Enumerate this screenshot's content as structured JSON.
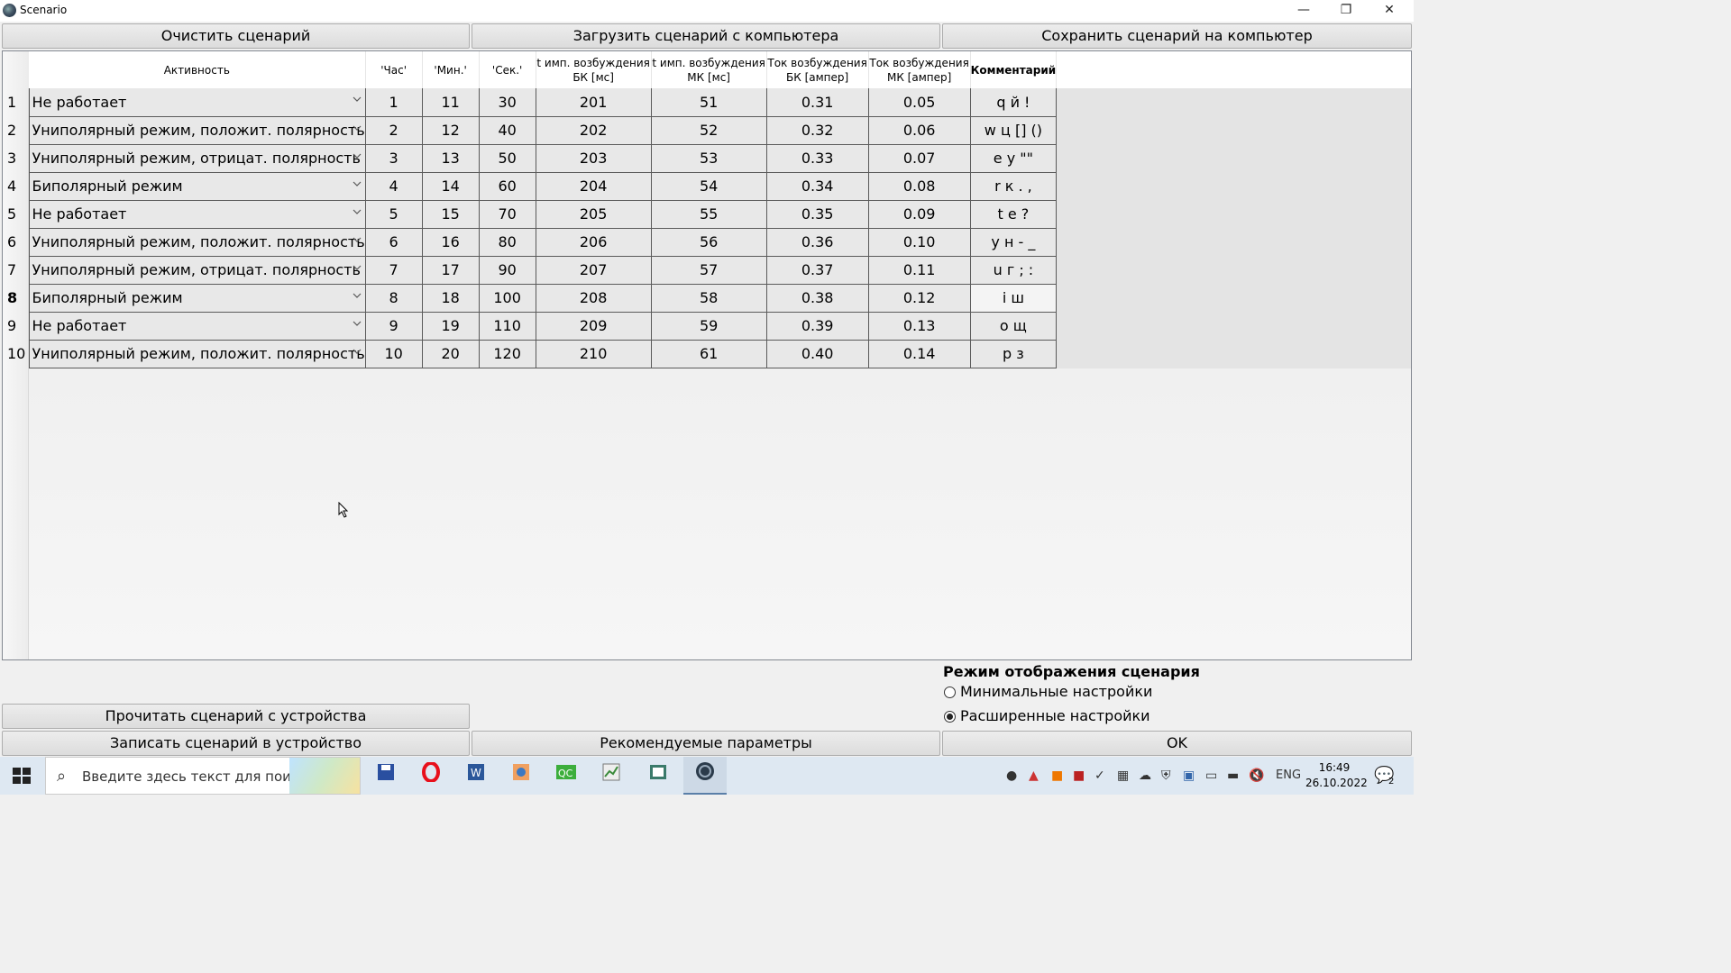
{
  "window": {
    "title": "Scenario",
    "minimize": "—",
    "restore": "❐",
    "close": "✕"
  },
  "toolbar": {
    "clear": "Очистить сценарий",
    "load": "Загрузить сценарий с компьютера",
    "save": "Сохранить сценарий на компьютер"
  },
  "table": {
    "headers": {
      "activity": "Активность",
      "hour": "'Час'",
      "min": "'Мин.'",
      "sec": "'Сек.'",
      "t_bk_1": "t имп. возбуждения",
      "t_bk_2": "БК [мс]",
      "t_mk_1": "t имп. возбуждения",
      "t_mk_2": "МК [мс]",
      "i_bk_1": "Ток возбуждения",
      "i_bk_2": "БК [ампер]",
      "i_mk_1": "Ток возбуждения",
      "i_mk_2": "МК [ампер]",
      "comment": "Комментарий"
    },
    "rows": [
      {
        "n": "1",
        "activity": "Не работает",
        "hour": "1",
        "min": "11",
        "sec": "30",
        "t_bk": "201",
        "t_mk": "51",
        "i_bk": "0.31",
        "i_mk": "0.05",
        "comment": "q й !"
      },
      {
        "n": "2",
        "activity": "Униполярный режим, положит. полярность",
        "hour": "2",
        "min": "12",
        "sec": "40",
        "t_bk": "202",
        "t_mk": "52",
        "i_bk": "0.32",
        "i_mk": "0.06",
        "comment": "w ц [] ()"
      },
      {
        "n": "3",
        "activity": "Униполярный режим, отрицат. полярность",
        "hour": "3",
        "min": "13",
        "sec": "50",
        "t_bk": "203",
        "t_mk": "53",
        "i_bk": "0.33",
        "i_mk": "0.07",
        "comment": "e у \"\""
      },
      {
        "n": "4",
        "activity": "Биполярный режим",
        "hour": "4",
        "min": "14",
        "sec": "60",
        "t_bk": "204",
        "t_mk": "54",
        "i_bk": "0.34",
        "i_mk": "0.08",
        "comment": "r к . ,"
      },
      {
        "n": "5",
        "activity": "Не работает",
        "hour": "5",
        "min": "15",
        "sec": "70",
        "t_bk": "205",
        "t_mk": "55",
        "i_bk": "0.35",
        "i_mk": "0.09",
        "comment": "t е ?"
      },
      {
        "n": "6",
        "activity": "Униполярный режим, положит. полярность",
        "hour": "6",
        "min": "16",
        "sec": "80",
        "t_bk": "206",
        "t_mk": "56",
        "i_bk": "0.36",
        "i_mk": "0.10",
        "comment": "y н - _"
      },
      {
        "n": "7",
        "activity": "Униполярный режим, отрицат. полярность",
        "hour": "7",
        "min": "17",
        "sec": "90",
        "t_bk": "207",
        "t_mk": "57",
        "i_bk": "0.37",
        "i_mk": "0.11",
        "comment": "u г ; :"
      },
      {
        "n": "8",
        "activity": "Биполярный режим",
        "hour": "8",
        "min": "18",
        "sec": "100",
        "t_bk": "208",
        "t_mk": "58",
        "i_bk": "0.38",
        "i_mk": "0.12",
        "comment": "i ш"
      },
      {
        "n": "9",
        "activity": "Не работает",
        "hour": "9",
        "min": "19",
        "sec": "110",
        "t_bk": "209",
        "t_mk": "59",
        "i_bk": "0.39",
        "i_mk": "0.13",
        "comment": "o щ"
      },
      {
        "n": "10",
        "activity": "Униполярный режим, положит. полярность",
        "hour": "10",
        "min": "20",
        "sec": "120",
        "t_bk": "210",
        "t_mk": "61",
        "i_bk": "0.40",
        "i_mk": "0.14",
        "comment": "p з"
      }
    ],
    "current_row": "8"
  },
  "display_mode": {
    "title": "Режим отображения сценария",
    "options": [
      {
        "label": "Минимальные настройки",
        "checked": false
      },
      {
        "label": "Расширенные настройки",
        "checked": true
      }
    ]
  },
  "bottom": {
    "read": "Прочитать сценарий с устройства",
    "write": "Записать сценарий в устройство",
    "recommended": "Рекомендуемые параметры",
    "ok": "OK"
  },
  "taskbar": {
    "search_placeholder": "Введите здесь текст для поиска",
    "apps": [
      "save-app-icon",
      "opera-icon",
      "word-icon",
      "eye-app-icon",
      "qc-app-icon",
      "chart-app-icon",
      "window-app-icon",
      "scenario-app-icon"
    ],
    "lang": "ENG",
    "time": "16:49",
    "date": "26.10.2022",
    "notif_count": "2"
  }
}
